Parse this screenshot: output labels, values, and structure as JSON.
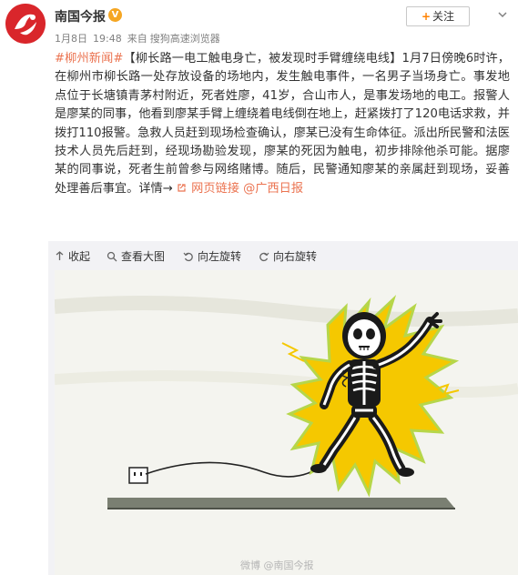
{
  "header": {
    "account_name": "南国今报",
    "verified_badge": "V",
    "date": "1月8日",
    "time": "19:48",
    "source_prefix": "来自",
    "source": "搜狗高速浏览器",
    "follow_label": "关注",
    "follow_plus": "+",
    "more_icon": "chevron-down-icon"
  },
  "post": {
    "topic": "#柳州新闻#",
    "title": "【柳长路一电工触电身亡，被发现时手臂缠绕电线】",
    "body": "1月7日傍晚6时许，在柳州市柳长路一处存放设备的场地内，发生触电事件，一名男子当场身亡。事发地点位于长塘镇青茅村附近，死者姓廖，41岁，合山市人，是事发场地的电工。报警人是廖某的同事，他看到廖某手臂上缠绕着电线倒在地上，赶紧拨打了120电话求救，并拨打110报警。急救人员赶到现场检查确认，廖某已没有生命体征。派出所民警和法医技术人员先后赶到，经现场勘验发现，廖某的死因为触电，初步排除他杀可能。据廖某的同事说，死者生前曾参与网络赌博。随后，民警通知廖某的亲属赶到现场，妥善处理善后事宜。",
    "detail_label": "详情→",
    "web_link_label": "网页链接",
    "mention": "@广西日报"
  },
  "media_toolbar": {
    "collapse": "收起",
    "view_large": "查看大图",
    "rotate_left": "向左旋转",
    "rotate_right": "向右旋转"
  },
  "image": {
    "watermark": "微博 @南国今报",
    "colors": {
      "wall": "#f4f4ef",
      "floor": "#7a7f72",
      "spark": "#f5c800",
      "spark_edge": "#b6d64a",
      "skeleton": "#ffffff",
      "body": "#1a1a1a"
    }
  },
  "colors": {
    "accent": "#eb7350",
    "follow_plus": "#ff8200",
    "brand_red": "#d9262b",
    "verified": "#f5a623",
    "meta_text": "#808080"
  }
}
